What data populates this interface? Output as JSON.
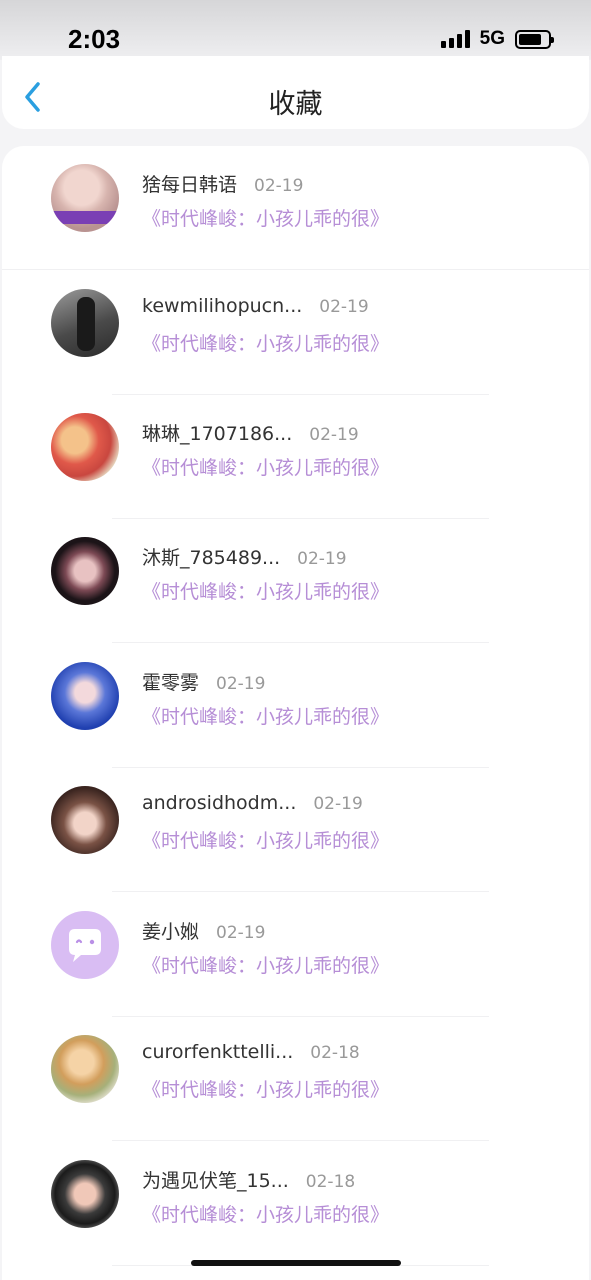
{
  "status_bar": {
    "time": "2:03",
    "network": "5G"
  },
  "header": {
    "title": "收藏"
  },
  "favorites": [
    {
      "name": "猞每日韩语",
      "date": "02-19",
      "work": "《时代峰峻：小孩儿乖的很》",
      "avatar": "photo"
    },
    {
      "name": "kewmilihopucn...",
      "date": "02-19",
      "work": "《时代峰峻：小孩儿乖的很》",
      "avatar": "photo"
    },
    {
      "name": "琳琳_1707186...",
      "date": "02-19",
      "work": "《时代峰峻：小孩儿乖的很》",
      "avatar": "photo"
    },
    {
      "name": "沐斯_785489...",
      "date": "02-19",
      "work": "《时代峰峻：小孩儿乖的很》",
      "avatar": "photo"
    },
    {
      "name": "霍零雾",
      "date": "02-19",
      "work": "《时代峰峻：小孩儿乖的很》",
      "avatar": "photo"
    },
    {
      "name": "androsidhodm...",
      "date": "02-19",
      "work": "《时代峰峻：小孩儿乖的很》",
      "avatar": "photo"
    },
    {
      "name": "姜小娰",
      "date": "02-19",
      "work": "《时代峰峻：小孩儿乖的很》",
      "avatar": "default-chat-icon"
    },
    {
      "name": "curorfenkttelli...",
      "date": "02-18",
      "work": "《时代峰峻：小孩儿乖的很》",
      "avatar": "photo"
    },
    {
      "name": "为遇见伏笔_15...",
      "date": "02-18",
      "work": "《时代峰峻：小孩儿乖的很》",
      "avatar": "photo"
    }
  ],
  "colors": {
    "accent": "#2a9fe0",
    "work_title": "#b68ed6",
    "default_avatar": "#d9bdf3"
  }
}
